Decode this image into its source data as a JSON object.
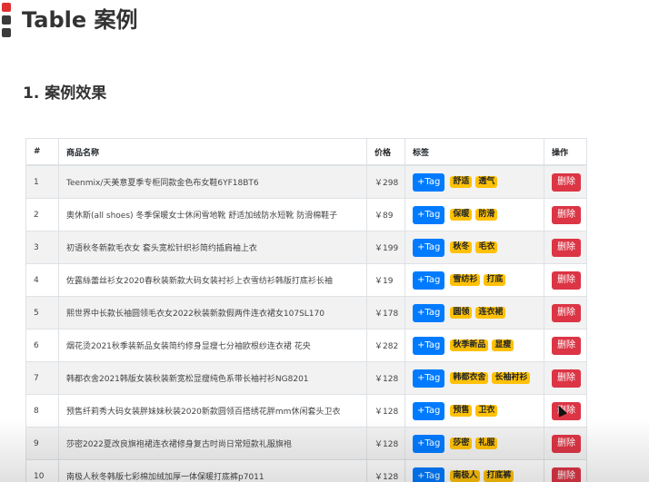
{
  "page": {
    "title": "Table 案例",
    "section_title": "1. 案例效果"
  },
  "table": {
    "headers": {
      "index": "#",
      "name": "商品名称",
      "price": "价格",
      "tags": "标签",
      "operation": "操作"
    },
    "add_tag_label": "+Tag",
    "delete_label": "删除",
    "rows": [
      {
        "index": "1",
        "name": "Teenmix/天美意夏季专柜同款金色布女鞋6YF18BT6",
        "price": "￥298",
        "tags": [
          "舒适",
          "透气"
        ]
      },
      {
        "index": "2",
        "name": "奥休斯(all shoes) 冬季保暖女士休闲雪地靴 舒适加绒防水短靴 防滑棉鞋子",
        "price": "￥89",
        "tags": [
          "保暖",
          "防滑"
        ]
      },
      {
        "index": "3",
        "name": "初语秋冬新款毛衣女 套头宽松针织衫简约插肩袖上衣",
        "price": "￥199",
        "tags": [
          "秋冬",
          "毛衣"
        ]
      },
      {
        "index": "4",
        "name": "佐露絲蕾丝衫女2020春秋装新款大码女装衬衫上衣雪纺衫韩版打底衫长袖",
        "price": "￥19",
        "tags": [
          "雪纺衫",
          "打底"
        ]
      },
      {
        "index": "5",
        "name": "熙世界中长款长袖圆领毛衣女2022秋装新款假两件连衣裙女107SL170",
        "price": "￥178",
        "tags": [
          "圆领",
          "连衣裙"
        ]
      },
      {
        "index": "6",
        "name": "烟花烫2021秋季装新品女装简约修身显瘦七分袖欧根纱连衣裙 花央",
        "price": "￥282",
        "tags": [
          "秋季新品",
          "显瘦"
        ]
      },
      {
        "index": "7",
        "name": "韩都衣舍2021韩版女装秋装新宽松显瘦纯色系带长袖衬衫NG8201",
        "price": "￥128",
        "tags": [
          "韩都衣舍",
          "长袖衬衫"
        ]
      },
      {
        "index": "8",
        "name": "预售纤莉秀大码女装胖妹妹秋装2020新款圆领百搭绣花胖mm休闲套头卫衣",
        "price": "￥128",
        "tags": [
          "预售",
          "卫衣"
        ]
      },
      {
        "index": "9",
        "name": "莎密2022夏改良旗袍裙连衣裙修身复古时尚日常短款礼服旗袍",
        "price": "￥128",
        "tags": [
          "莎密",
          "礼服"
        ]
      },
      {
        "index": "10",
        "name": "南极人秋冬韩版七彩棉加绒加厚一体保暖打底裤p7011",
        "price": "￥128",
        "tags": [
          "南极人",
          "打底裤"
        ]
      }
    ]
  },
  "colors": {
    "marker_red": "#e03131",
    "marker_dark": "#3b3b3b",
    "primary": "#007bff",
    "warning": "#ffc107",
    "danger": "#dc3545"
  },
  "icons": {
    "cursor": "mouse-pointer-icon"
  }
}
